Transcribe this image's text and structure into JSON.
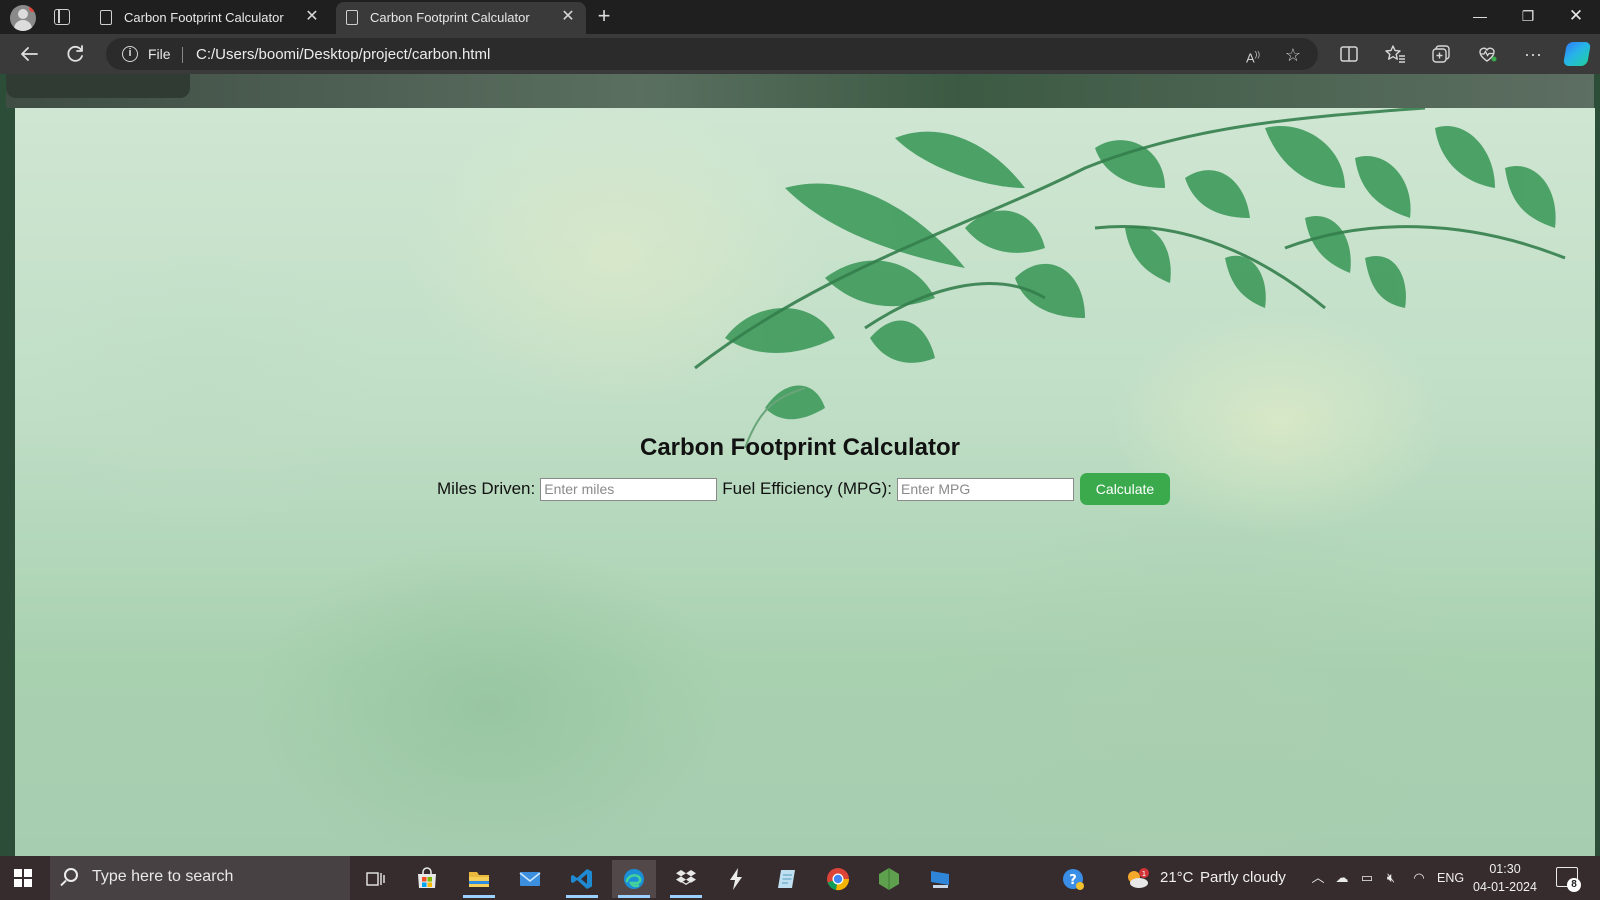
{
  "browser": {
    "tabs": [
      {
        "title": "Carbon Footprint Calculator",
        "close": "✕"
      },
      {
        "title": "Carbon Footprint Calculator",
        "close": "✕"
      }
    ],
    "new_tab": "+",
    "window_controls": {
      "minimize": "—",
      "maximize": "❐",
      "close": "✕"
    },
    "address": {
      "scheme_label": "File",
      "url": "C:/Users/boomi/Desktop/project/carbon.html"
    },
    "toolbar_icons": [
      "read-aloud-icon",
      "favorite-star-icon",
      "split-screen-icon",
      "favorites-icon",
      "collections-icon",
      "browser-essentials-icon",
      "more-icon",
      "copilot-icon"
    ]
  },
  "page": {
    "title": "Carbon Footprint Calculator",
    "miles_label": "Miles Driven:",
    "miles_placeholder": "Enter miles",
    "mpg_label": "Fuel Efficiency (MPG):",
    "mpg_placeholder": "Enter MPG",
    "calculate_label": "Calculate",
    "accent_color": "#3aaa4c"
  },
  "taskbar": {
    "search_placeholder": "Type here to search",
    "apps": [
      "task-view",
      "microsoft-store",
      "file-explorer",
      "mail",
      "vscode",
      "edge",
      "dropbox",
      "app-bolt",
      "app-notes",
      "chrome",
      "node-js",
      "remote-desktop"
    ],
    "weather": {
      "temperature": "21°C",
      "condition": "Partly cloudy",
      "alert_count": "1"
    },
    "language": "ENG",
    "time": "01:30",
    "date": "04-01-2024",
    "notification_count": "8"
  }
}
